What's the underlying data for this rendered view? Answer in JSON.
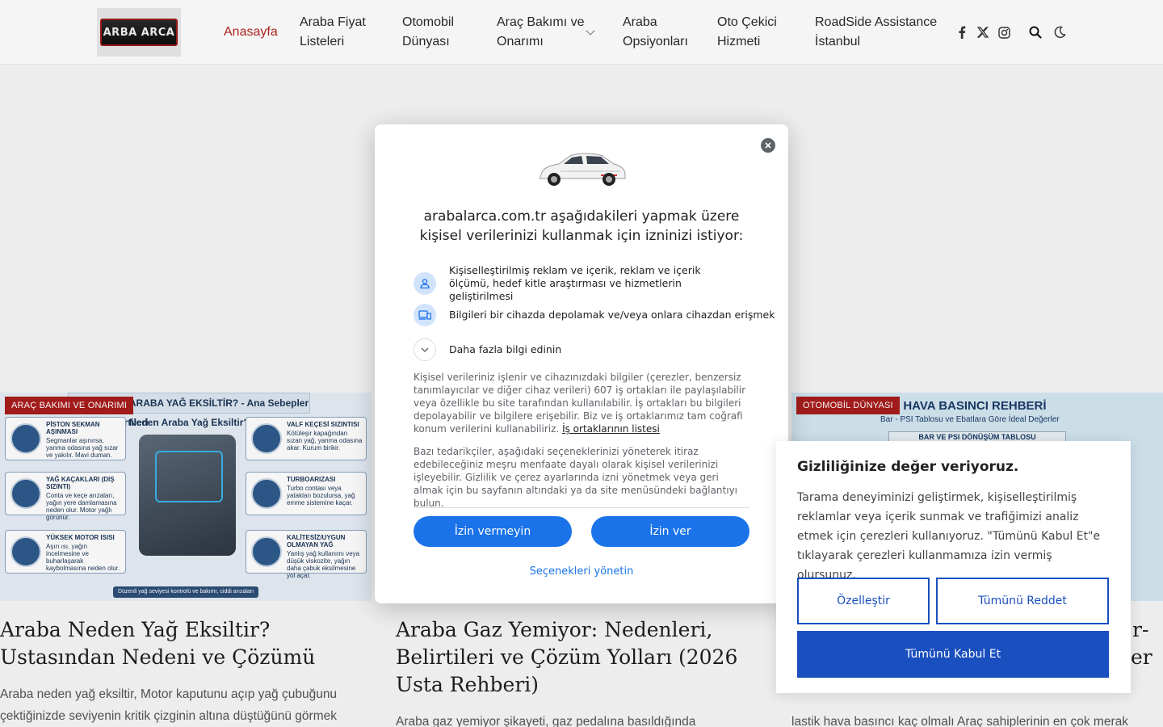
{
  "logo": {
    "text": "ARBA ARCA"
  },
  "nav": {
    "items": [
      {
        "label": "Anasayfa",
        "active": true
      },
      {
        "label": "Araba Fiyat\nListeleri"
      },
      {
        "label": "Otomobil\nDünyası"
      },
      {
        "label": "Araç Bakımı ve\nOnarımı",
        "has_dropdown": true
      },
      {
        "label": "Araba\nOpsiyonları"
      },
      {
        "label": "Oto Çekici\nHizmeti"
      },
      {
        "label": "RoadSide Assistance\nİstanbul"
      }
    ],
    "icons": [
      "facebook-icon",
      "x-twitter-icon",
      "instagram-icon",
      "search-icon",
      "dark-mode-icon"
    ]
  },
  "articles": [
    {
      "category": "ARAÇ BAKIMI VE ONARIMI",
      "title": "Araba Neden Yağ Eksiltir? Ustasından Nedeni ve Çözümü",
      "excerpt": "Araba neden yağ eksiltir, Motor kaputunu açıp yağ çubuğunu çektiğinizde seviyenin kritik çizginin altına düştüğünü görmek",
      "image": {
        "header": "NEDEN ARABA YAĞ EKSİLTİR? - Ana Sebepler ve Belirtileri",
        "subtitle": "Neden Araba Yağ Eksiltir?",
        "boxes": [
          {
            "title": "PİSTON SEKMAN AŞINMASI",
            "text": "Segmanlar aşınırsa, yanma odasına yağ sızar ve yakılır. Mavi duman."
          },
          {
            "title": "YAĞ KAÇAKLARI (DIŞ SIZINTI)",
            "text": "Conta ve keçe arızaları, yağın yere damlamasına neden olur. Motor yağlı görünür."
          },
          {
            "title": "YÜKSEK MOTOR ISISI",
            "text": "Aşırı ısı, yağın incelmesine ve buharlaşarak kaybolmasına neden olur."
          },
          {
            "title": "VALF KEÇESİ SIZINTISI",
            "text": "Kötüleşir kapağından sızan yağ, yanma odasına akar. Kurum birikir."
          },
          {
            "title": "TURBOARIZASI",
            "text": "Turbo contası veya yatakları bozulursa, yağ emme sistemine kaçar."
          },
          {
            "title": "KALİTESİZ/UYGUN OLMAYAN YAĞ",
            "text": "Yanlış yağ kullanımı veya düşük viskozite, yağın daha çabuk eksilmesine yol açar."
          }
        ],
        "footer": "Düzenli yağ seviyesi kontrolü ve bakımı, ciddi arızaları önler."
      }
    },
    {
      "category": "",
      "title": "Araba Gaz Yemiyor: Nedenleri, Belirtileri ve Çözüm Yolları (2026 Usta Rehberi)",
      "excerpt": "Araba gaz yemiyor şikayeti, gaz pedalına basıldığında"
    },
    {
      "category": "OTOMOBİL DÜNYASI",
      "title_tail_1": "r-",
      "title_tail_2": "er",
      "excerpt": "lastik hava basıncı kaç olmalı Araç sahiplerinin en çok merak",
      "image": {
        "title": "LASTİK HAVA BASINCI REHBERİ",
        "subtitle": "Bar - PSI Tablosu ve Ebatlara Göre İdeal Değerler",
        "bar": "BAR VE PSI DÖNÜŞÜM TABLOSU"
      }
    }
  ],
  "consent": {
    "title": "arabalarca.com.tr aşağıdakileri yapmak üzere kişisel verilerinizi kullanmak için izninizi istiyor:",
    "purposes": [
      {
        "icon": "person-icon",
        "text": "Kişiselleştirilmiş reklam ve içerik, reklam ve içerik ölçümü, hedef kitle araştırması ve hizmetlerin geliştirilmesi"
      },
      {
        "icon": "devices-icon",
        "text": "Bilgileri bir cihazda depolamak ve/veya onlara cihazdan erişmek"
      },
      {
        "icon": "chevron-down-icon",
        "text": "Daha fazla bilgi edinin"
      }
    ],
    "para1": "Kişisel verileriniz işlenir ve cihazınızdaki bilgiler (çerezler, benzersiz tanımlayıcılar ve diğer cihaz verileri) 607 iş ortakları ile paylaşılabilir veya özellikle bu site tarafından kullanılabilir. İş ortakları bu bilgileri depolayabilir ve bilgilere erişebilir. Biz ve iş ortaklarımız tam coğrafi konum verilerini kullanabiliriz.",
    "para1_link": "İş ortaklarının listesi",
    "para2": "Bazı tedarikçiler, aşağıdaki seçeneklerinizi yöneterek itiraz edebileceğiniz meşru menfaate dayalı olarak kişisel verilerinizi işleyebilir. Gizlilik ve çerez ayarlarında izni yönetmek veya geri almak için bu sayfanın altındaki ya da site menüsündeki bağlantıyı bulun.",
    "deny_label": "İzin vermeyin",
    "allow_label": "İzin ver",
    "manage_label": "Seçenekleri yönetin"
  },
  "cookie": {
    "title": "Gizliliğinize değer veriyoruz.",
    "text": "Tarama deneyiminizi geliştirmek, kişiselleştirilmiş reklamlar veya içerik sunmak ve trafiğimizi analiz etmek için çerezleri kullanıyoruz. \"Tümünü Kabul Et\"e tıklayarak çerezleri kullanmamıza izin vermiş olursunuz.",
    "customize_label": "Özelleştir",
    "reject_label": "Tümünü Reddet",
    "accept_label": "Tümünü Kabul Et"
  },
  "colors": {
    "accent_red": "#b3261e",
    "google_blue": "#1a73e8",
    "cookie_blue": "#1a4fbf"
  }
}
